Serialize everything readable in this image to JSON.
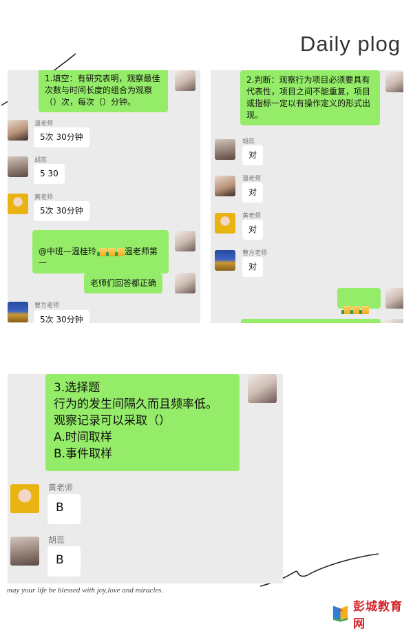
{
  "title": "Daily plog",
  "panel_a": {
    "messages": [
      {
        "text": "1.填空：有研究表明，观察最佳次数与时间长度的组合为观察（）次，每次（）分钟。"
      },
      {
        "sender": "温老师",
        "text": "5次  30分钟"
      },
      {
        "sender": "胡蕊",
        "text": "5  30"
      },
      {
        "sender": "黄老师",
        "text": "5次  30分钟"
      },
      {
        "text_before": "@中班—温桂玲 ",
        "text_after": "温老师第一"
      },
      {
        "text": "老师们回答都正确"
      },
      {
        "sender": "曹方老师",
        "text": "5次  30分钟"
      }
    ]
  },
  "panel_b": {
    "messages": [
      {
        "text": "2.判断：观察行为项目必须要具有代表性，项目之间不能重复，项目或指标一定以有操作定义的形式出现。"
      },
      {
        "sender": "胡蕊",
        "text": "对"
      },
      {
        "sender": "温老师",
        "text": "对"
      },
      {
        "sender": "黄老师",
        "text": "对"
      },
      {
        "sender": "曹方老师",
        "text": "对"
      }
    ]
  },
  "panel_c": {
    "messages": [
      {
        "text": "3.选择题\n行为的发生间隔久而且频率低。\n观察记录可以采取（）\nA.时间取样\nB.事件取样"
      },
      {
        "sender": "黄老师",
        "text": "B"
      },
      {
        "sender": "胡蕊",
        "text": "B"
      }
    ]
  },
  "footer": {
    "tagline": "may your life be blessed with joy,love and miracles.",
    "logo_text": "彭城教育网"
  },
  "colors": {
    "green_bubble": "#95ec69",
    "panel_bg": "#ebebeb",
    "logo_red": "#d2232a"
  }
}
